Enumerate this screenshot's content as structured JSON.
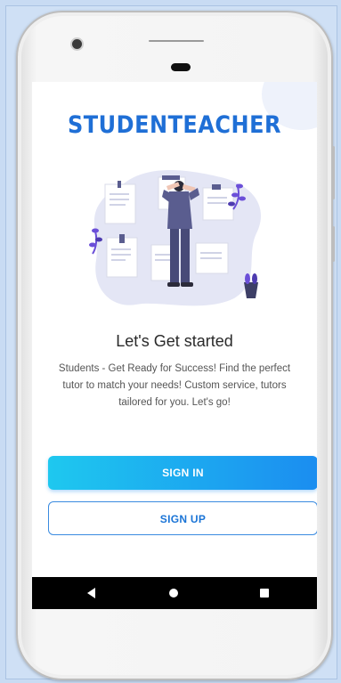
{
  "app": {
    "brand": "STUDENTEACHER"
  },
  "onboarding": {
    "headline": "Let's Get started",
    "description": "Students - Get Ready for Success! Find the perfect tutor to match your needs! Custom service, tutors tailored for you. Let's go!"
  },
  "actions": {
    "sign_in_label": "SIGN IN",
    "sign_up_label": "SIGN UP"
  },
  "system_nav": {
    "back_icon": "back-triangle-icon",
    "home_icon": "home-circle-icon",
    "recents_icon": "recents-square-icon"
  },
  "colors": {
    "brand": "#1f6fd6",
    "primary_gradient_start": "#1ec8ef",
    "primary_gradient_end": "#1b8df0",
    "outline_button": "#3a8be0",
    "illustration_blob": "#e4e6f5",
    "person_suit": "#5a5d8f",
    "leaves": "#6b4fd8"
  }
}
